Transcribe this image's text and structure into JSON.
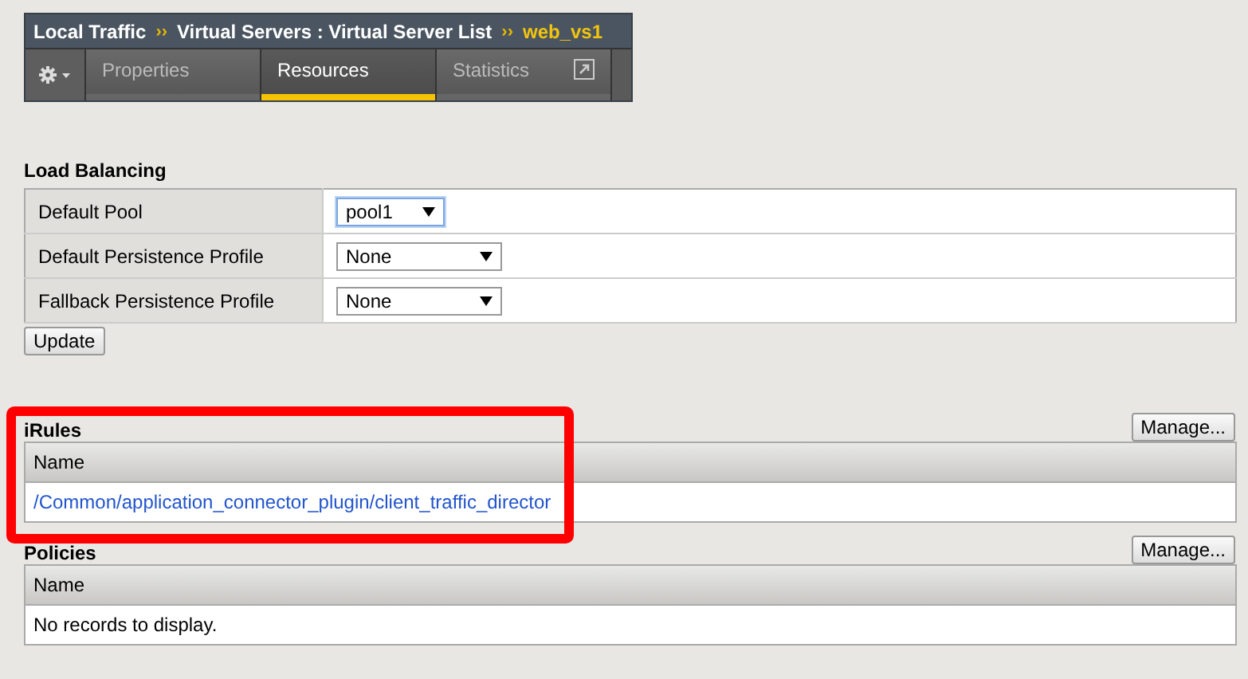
{
  "breadcrumb": {
    "items": [
      "Local Traffic",
      "Virtual Servers : Virtual Server List"
    ],
    "current": "web_vs1",
    "separator": "››"
  },
  "tabs": [
    {
      "label": "Properties",
      "selected": false,
      "popout": false
    },
    {
      "label": "Resources",
      "selected": true,
      "popout": false
    },
    {
      "label": "Statistics",
      "selected": false,
      "popout": true
    }
  ],
  "load_balancing": {
    "title": "Load Balancing",
    "rows": [
      {
        "label": "Default Pool",
        "value": "pool1",
        "focused": true
      },
      {
        "label": "Default Persistence Profile",
        "value": "None",
        "focused": false
      },
      {
        "label": "Fallback Persistence Profile",
        "value": "None",
        "focused": false
      }
    ],
    "button": "Update"
  },
  "sections": [
    {
      "title": "iRules",
      "button": "Manage...",
      "column": "Name",
      "kind": "link",
      "rows": [
        "/Common/application_connector_plugin/client_traffic_director"
      ],
      "highlighted": true
    },
    {
      "title": "Policies",
      "button": "Manage...",
      "column": "Name",
      "kind": "empty",
      "rows": [
        "No records to display."
      ],
      "highlighted": false
    }
  ]
}
